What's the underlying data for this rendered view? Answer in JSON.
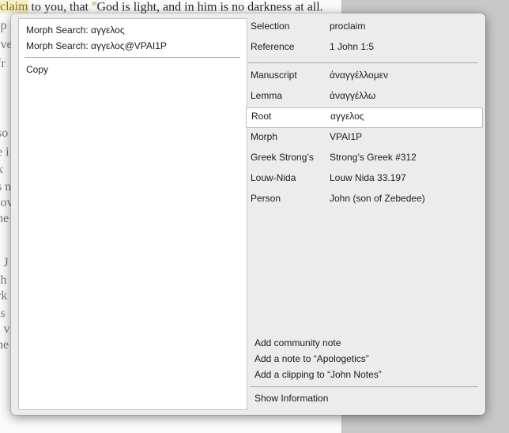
{
  "document": {
    "top_line": {
      "highlight": "claim",
      "text_before_sup": " to you, that ",
      "superscript": "m",
      "text_after_sup": "God is light, and in him is no darkness at all."
    },
    "left_fragments": [
      "ip",
      "lve",
      "fr",
      "so",
      "e i",
      "k",
      "s n",
      "lov",
      "he",
      "t J",
      "th",
      "rk",
      "is",
      "t v",
      "he"
    ]
  },
  "context_menu": {
    "items": [
      "Morph Search: αγγελος",
      "Morph Search: αγγελος@VPAI1P"
    ],
    "copy_label": "Copy"
  },
  "info": {
    "rows": [
      {
        "label": "Selection",
        "value": "proclaim"
      },
      {
        "label": "Reference",
        "value": "1 John 1:5"
      },
      {
        "label": "Manuscript",
        "value": "ἀναγγέλλομεν"
      },
      {
        "label": "Lemma",
        "value": "ἀναγγέλλω"
      },
      {
        "label": "Root",
        "value": "αγγελος"
      },
      {
        "label": "Morph",
        "value": "VPAI1P"
      },
      {
        "label": "Greek Strong’s",
        "value": "Strong’s Greek #312"
      },
      {
        "label": "Louw-Nida",
        "value": "Louw Nida 33.197"
      },
      {
        "label": "Person",
        "value": "John (son of Zebedee)"
      }
    ],
    "selected_row": "Root"
  },
  "actions": {
    "add_community_note": "Add community note",
    "add_note": "Add a note to “Apologetics”",
    "add_clipping": "Add a clipping to “John Notes”",
    "show_information": "Show Information"
  }
}
